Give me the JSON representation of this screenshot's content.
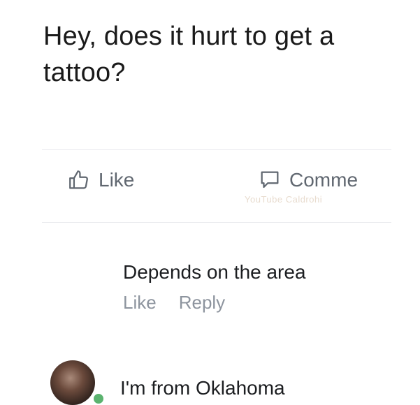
{
  "post": {
    "line1": "Hey, does it hurt to get a",
    "line2": "tattoo?"
  },
  "actions": {
    "like_label": "Like",
    "comment_label": "Comme"
  },
  "watermark": "YouTube Caldrohi",
  "comments": [
    {
      "text": "Depends on the area",
      "like_label": "Like",
      "reply_label": "Reply"
    },
    {
      "text": "I'm from Oklahoma"
    }
  ],
  "colors": {
    "text_primary": "#1c1e21",
    "text_muted": "#8d949e",
    "action_gray": "#606770",
    "online_green": "#5bb36f"
  },
  "icons": {
    "like": "thumbs-up-icon",
    "comment": "speech-bubble-icon"
  }
}
